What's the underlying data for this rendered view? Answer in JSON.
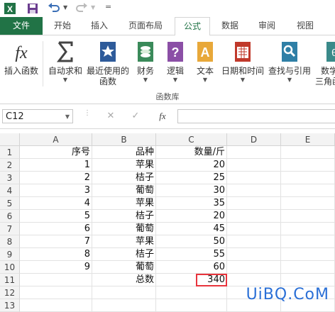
{
  "tabs": [
    "文件",
    "开始",
    "插入",
    "页面布局",
    "公式",
    "数据",
    "审阅",
    "视图"
  ],
  "ribbon": {
    "buttons": [
      {
        "label": "插入函数",
        "icon": "function-icon"
      },
      {
        "label": "自动求和",
        "icon": "sigma-icon",
        "dropdown": true
      },
      {
        "label": "最近使用的",
        "label2": "函数",
        "icon": "star-book-icon",
        "dropdown": true
      },
      {
        "label": "财务",
        "icon": "finance-icon",
        "dropdown": true
      },
      {
        "label": "逻辑",
        "icon": "logic-icon",
        "dropdown": true
      },
      {
        "label": "文本",
        "icon": "text-icon",
        "dropdown": true
      },
      {
        "label": "日期和时间",
        "icon": "calendar-icon",
        "dropdown": true
      },
      {
        "label": "查找与引用",
        "icon": "lookup-icon",
        "dropdown": true
      },
      {
        "label": "数学",
        "label2": "三角函",
        "icon": "math-icon"
      }
    ],
    "group_label": "函数库"
  },
  "formula_bar": {
    "name_box": "C12",
    "fx": "fx",
    "formula": ""
  },
  "columns": [
    "A",
    "B",
    "C",
    "D",
    "E"
  ],
  "rows": [
    {
      "n": "1",
      "a": "序号",
      "b": "品种",
      "c": "数量/斤"
    },
    {
      "n": "2",
      "a": "1",
      "b": "苹果",
      "c": "20"
    },
    {
      "n": "3",
      "a": "2",
      "b": "桔子",
      "c": "25"
    },
    {
      "n": "4",
      "a": "3",
      "b": "葡萄",
      "c": "30"
    },
    {
      "n": "5",
      "a": "4",
      "b": "苹果",
      "c": "35"
    },
    {
      "n": "6",
      "a": "5",
      "b": "桔子",
      "c": "20"
    },
    {
      "n": "7",
      "a": "6",
      "b": "葡萄",
      "c": "45"
    },
    {
      "n": "8",
      "a": "7",
      "b": "苹果",
      "c": "50"
    },
    {
      "n": "9",
      "a": "8",
      "b": "桔子",
      "c": "55"
    },
    {
      "n": "10",
      "a": "9",
      "b": "葡萄",
      "c": "60"
    },
    {
      "n": "11",
      "a": "",
      "b": "总数",
      "c": "340"
    },
    {
      "n": "12",
      "a": "",
      "b": "",
      "c": ""
    },
    {
      "n": "13",
      "a": "",
      "b": "",
      "c": ""
    }
  ],
  "watermark": "UiBQ.CoM"
}
